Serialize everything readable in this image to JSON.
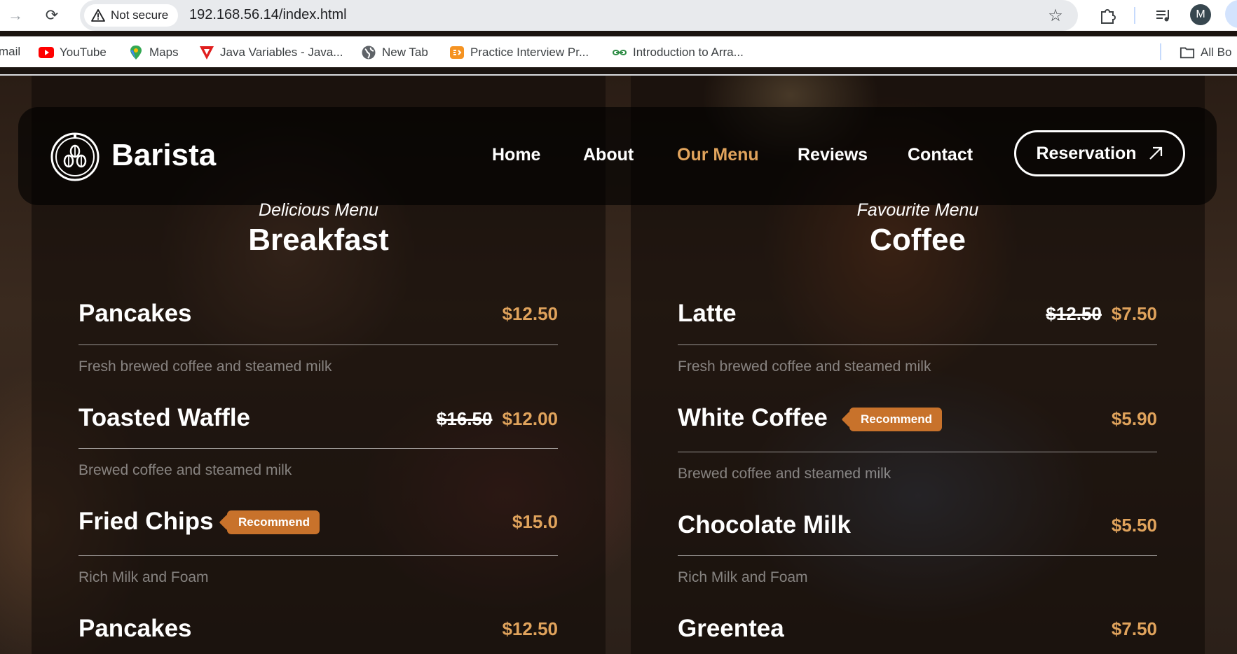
{
  "browser": {
    "security_label": "Not secure",
    "url": "192.168.56.14/index.html",
    "avatar_letter": "M",
    "bookmarks": [
      {
        "label": "mail"
      },
      {
        "label": "YouTube"
      },
      {
        "label": "Maps"
      },
      {
        "label": "Java Variables - Java..."
      },
      {
        "label": "New Tab"
      },
      {
        "label": "Practice Interview Pr..."
      },
      {
        "label": "Introduction to Arra..."
      },
      {
        "label": "All Bo"
      }
    ]
  },
  "site": {
    "brand": "Barista",
    "nav": [
      "Home",
      "About",
      "Our Menu",
      "Reviews",
      "Contact"
    ],
    "active_nav": "Our Menu",
    "reservation_label": "Reservation",
    "accent_color": "#e0a35c",
    "badge_color": "#c8722b"
  },
  "menus": {
    "breakfast": {
      "subtitle": "Delicious Menu",
      "title": "Breakfast",
      "items": [
        {
          "name": "Pancakes",
          "old_price": "",
          "price": "$12.50",
          "badge": "",
          "desc": "Fresh brewed coffee and steamed milk"
        },
        {
          "name": "Toasted Waffle",
          "old_price": "$16.50",
          "price": "$12.00",
          "badge": "",
          "desc": "Brewed coffee and steamed milk"
        },
        {
          "name": "Fried Chips",
          "old_price": "",
          "price": "$15.0",
          "badge": "Recommend",
          "desc": "Rich Milk and Foam"
        },
        {
          "name": "Pancakes",
          "old_price": "",
          "price": "$12.50",
          "badge": "",
          "desc": ""
        }
      ]
    },
    "coffee": {
      "subtitle": "Favourite Menu",
      "title": "Coffee",
      "items": [
        {
          "name": "Latte",
          "old_price": "$12.50",
          "price": "$7.50",
          "badge": "",
          "desc": "Fresh brewed coffee and steamed milk"
        },
        {
          "name": "White Coffee",
          "old_price": "",
          "price": "$5.90",
          "badge": "Recommend",
          "desc": "Brewed coffee and steamed milk"
        },
        {
          "name": "Chocolate Milk",
          "old_price": "",
          "price": "$5.50",
          "badge": "",
          "desc": "Rich Milk and Foam"
        },
        {
          "name": "Greentea",
          "old_price": "",
          "price": "$7.50",
          "badge": "",
          "desc": ""
        }
      ]
    }
  }
}
